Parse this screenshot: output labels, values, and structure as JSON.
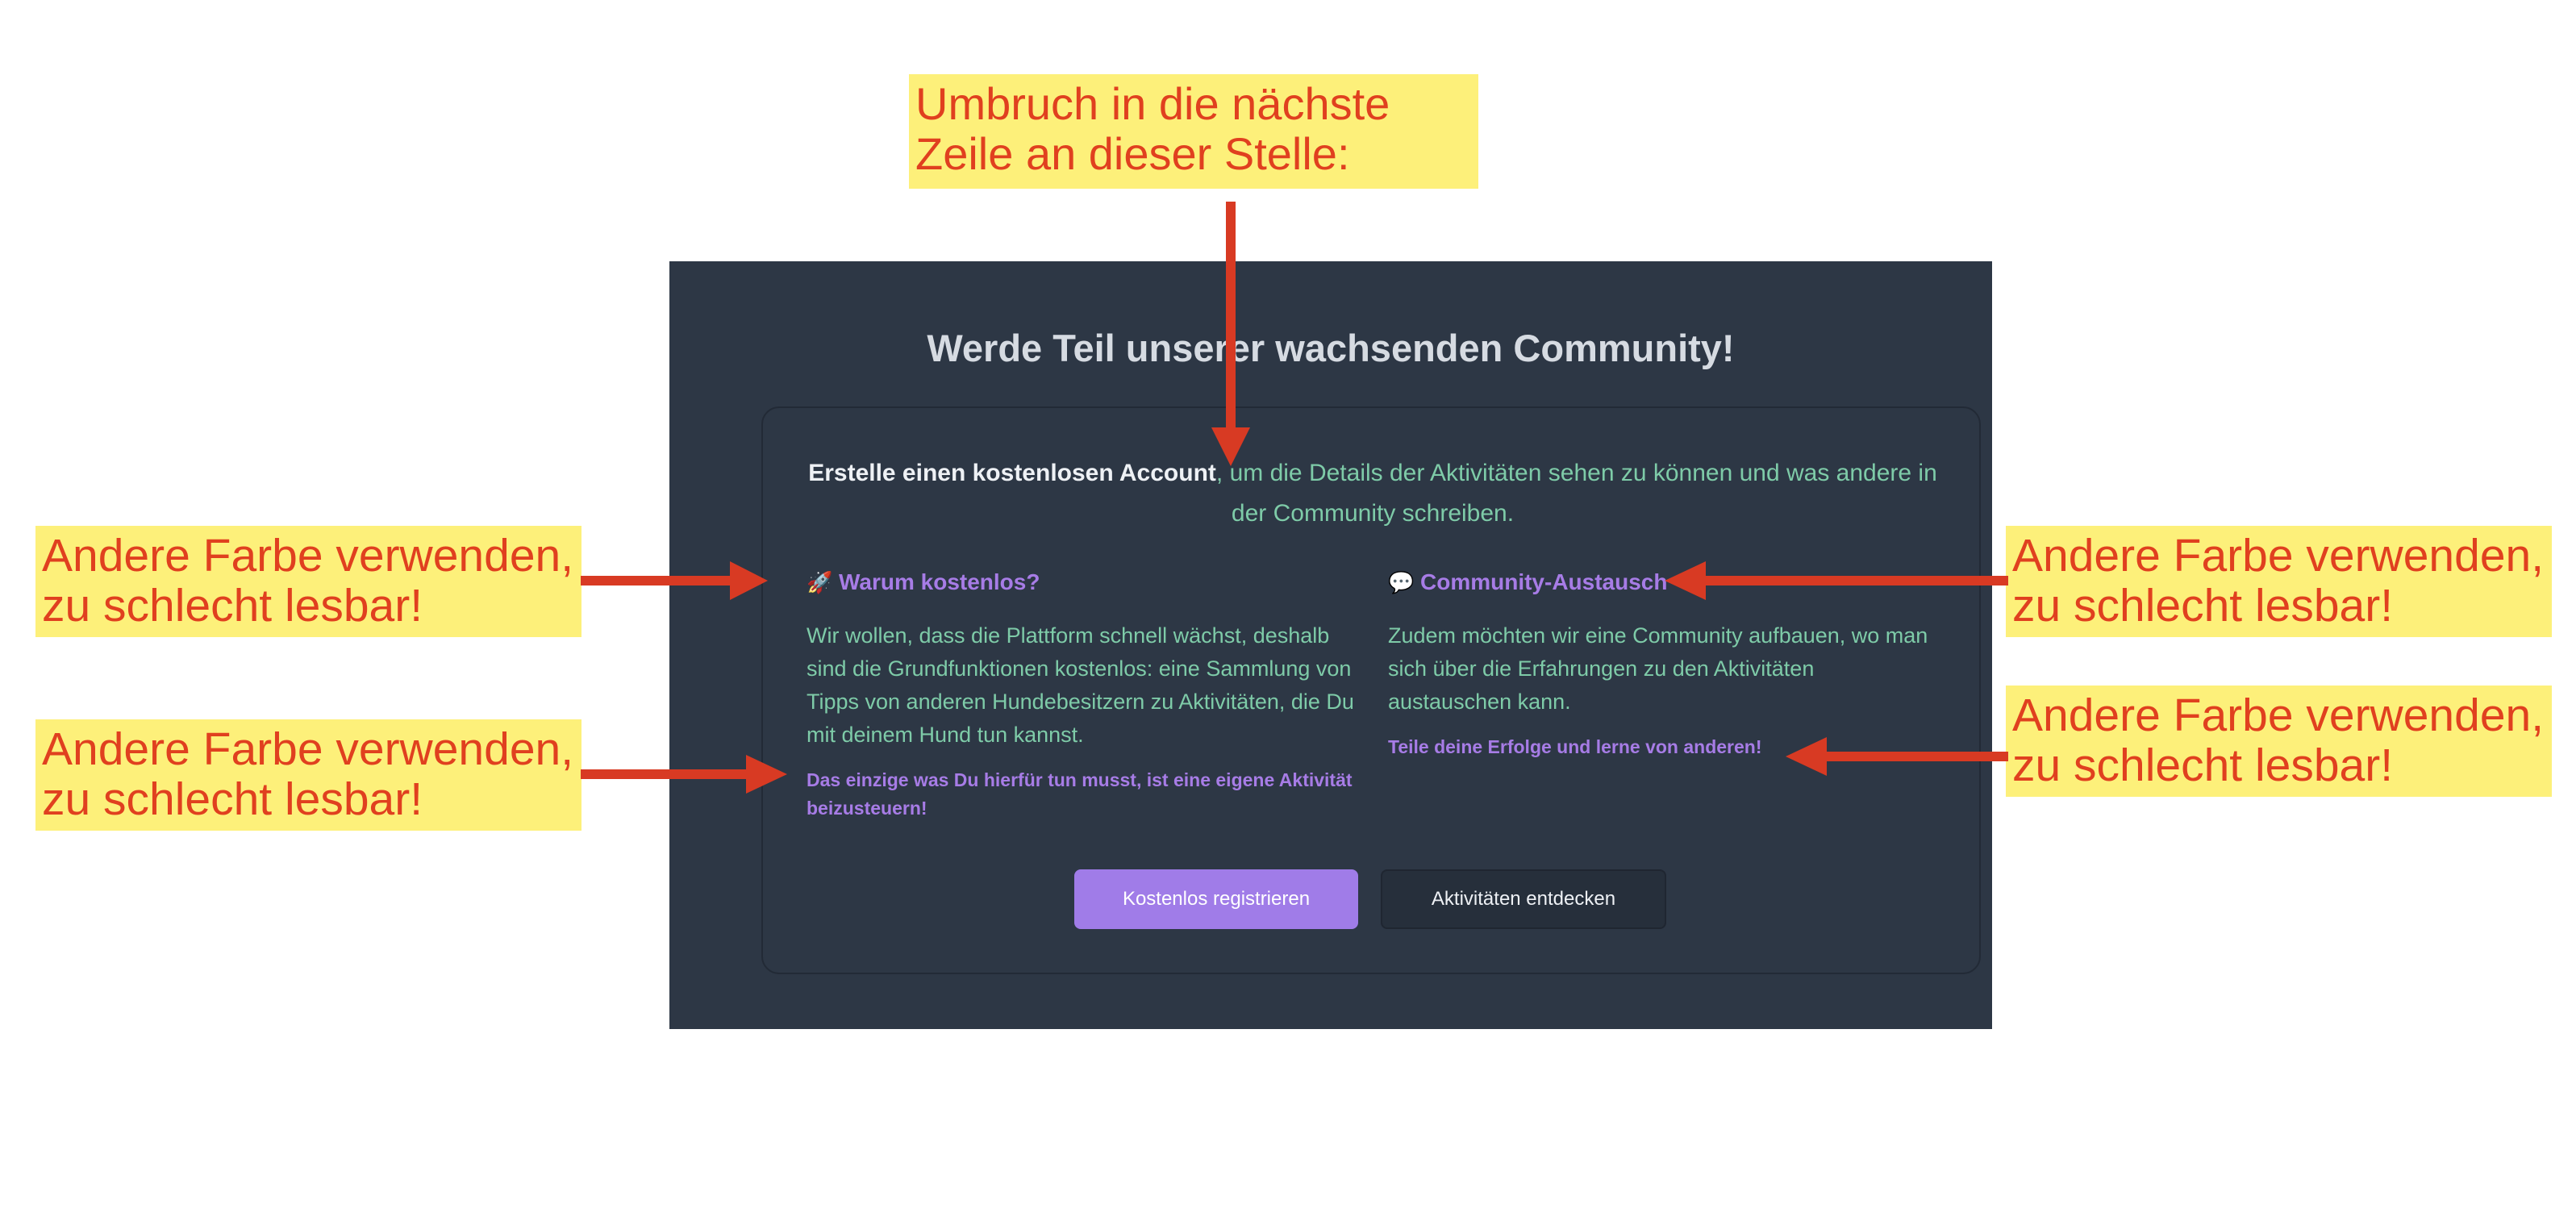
{
  "annotations": {
    "top": "Umbruch in die nächste Zeile an dieser Stelle:",
    "left_1": "Andere Farbe verwenden, zu schlecht lesbar!",
    "left_2": "Andere Farbe verwenden, zu schlecht lesbar!",
    "right_1": "Andere Farbe verwenden, zu schlecht lesbar!",
    "right_2": "Andere Farbe verwenden, zu schlecht lesbar!",
    "color_text": "#e0401f",
    "color_bg": "#fdf07a",
    "color_arrow": "#d83a23"
  },
  "panel": {
    "title": "Werde Teil unserer wachsenden Community!",
    "background": "#2d3745"
  },
  "card": {
    "intro_strong": "Erstelle einen kostenlosen Account",
    "intro_rest": ", um die Details der Aktivitäten sehen zu können und was andere in der Community schreiben.",
    "left": {
      "icon": "rocket-icon",
      "icon_glyph": "🚀",
      "title": "Warum kostenlos?",
      "body": "Wir wollen, dass die Plattform schnell wächst, deshalb sind die Grundfunktionen kostenlos: eine Sammlung von Tipps von anderen Hundebesitzern zu Aktivitäten, die Du mit deinem Hund tun kannst.",
      "note": "Das einzige was Du hierfür tun musst, ist eine eigene Aktivität beizusteuern!"
    },
    "right": {
      "icon": "speech-bubble-icon",
      "icon_glyph": "💬",
      "title": "Community-Austausch",
      "body": "Zudem möchten wir eine Community aufbauen, wo man sich über die Erfahrungen zu den Aktivitäten austauschen kann.",
      "note": "Teile deine Erfolge und lerne von anderen!"
    },
    "buttons": {
      "register": "Kostenlos registrieren",
      "discover": "Aktivitäten entdecken"
    },
    "colors": {
      "accent_purple": "#a07ce8",
      "text_green": "#7ecba8"
    }
  }
}
